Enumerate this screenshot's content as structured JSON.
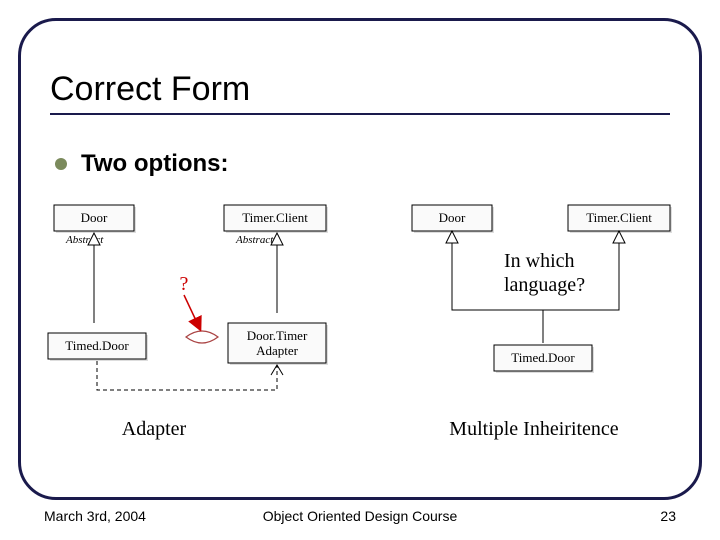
{
  "title": "Correct Form",
  "bullet": "Two options:",
  "left_diagram": {
    "door": "Door",
    "door_stereo": "Abstract",
    "timer_client": "Timer.Client",
    "timer_client_stereo": "Abstract",
    "timed_door": "Timed.Door",
    "adapter": "Door.Timer Adapter",
    "question": "?",
    "caption": "Adapter"
  },
  "right_diagram": {
    "door": "Door",
    "timer_client": "Timer.Client",
    "timed_door": "Timed.Door",
    "overlay_line1": "In which",
    "overlay_line2": "language?",
    "caption": "Multiple Inheiritence"
  },
  "footer": {
    "left": "March 3rd, 2004",
    "center": "Object Oriented Design Course",
    "right": "23"
  }
}
